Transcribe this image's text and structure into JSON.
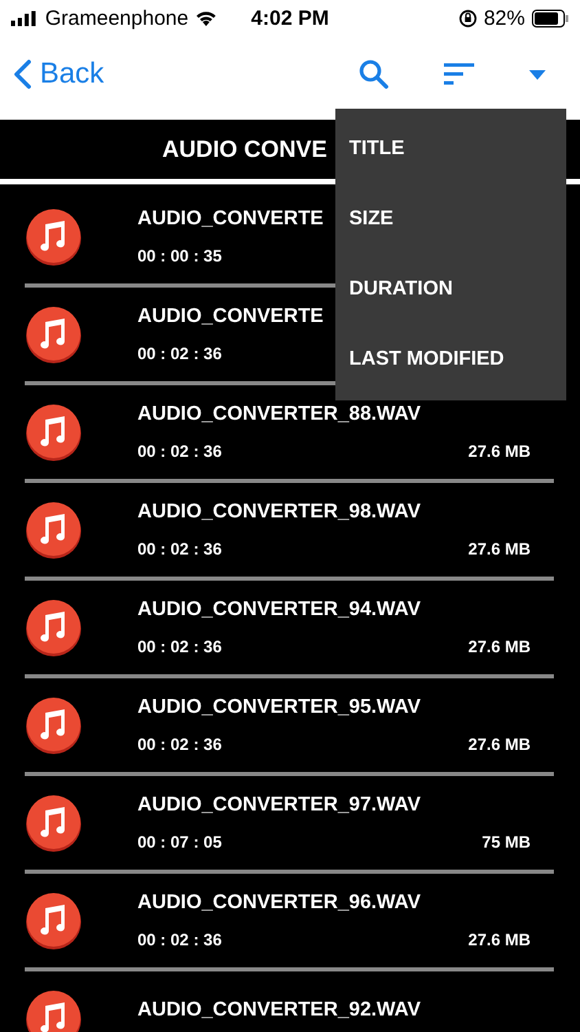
{
  "status_bar": {
    "carrier": "Grameenphone",
    "time": "4:02 PM",
    "battery": "82%"
  },
  "nav": {
    "back": "Back"
  },
  "header": {
    "title": "AUDIO CONVE"
  },
  "sort_menu": {
    "items": [
      "TITLE",
      "SIZE",
      "DURATION",
      "LAST MODIFIED"
    ]
  },
  "files": [
    {
      "name": "AUDIO_CONVERTE",
      "duration": "00 : 00 : 35"
    },
    {
      "name": "AUDIO_CONVERTE",
      "duration": "00 : 02 : 36"
    },
    {
      "name": "AUDIO_CONVERTER_88.WAV",
      "duration": "00 : 02 : 36",
      "size": "27.6 MB"
    },
    {
      "name": "AUDIO_CONVERTER_98.WAV",
      "duration": "00 : 02 : 36",
      "size": "27.6 MB"
    },
    {
      "name": "AUDIO_CONVERTER_94.WAV",
      "duration": "00 : 02 : 36",
      "size": "27.6 MB"
    },
    {
      "name": "AUDIO_CONVERTER_95.WAV",
      "duration": "00 : 02 : 36",
      "size": "27.6 MB"
    },
    {
      "name": "AUDIO_CONVERTER_97.WAV",
      "duration": "00 : 07 : 05",
      "size": "75 MB"
    },
    {
      "name": "AUDIO_CONVERTER_96.WAV",
      "duration": "00 : 02 : 36",
      "size": "27.6 MB"
    },
    {
      "name": "AUDIO_CONVERTER_92.WAV"
    }
  ]
}
